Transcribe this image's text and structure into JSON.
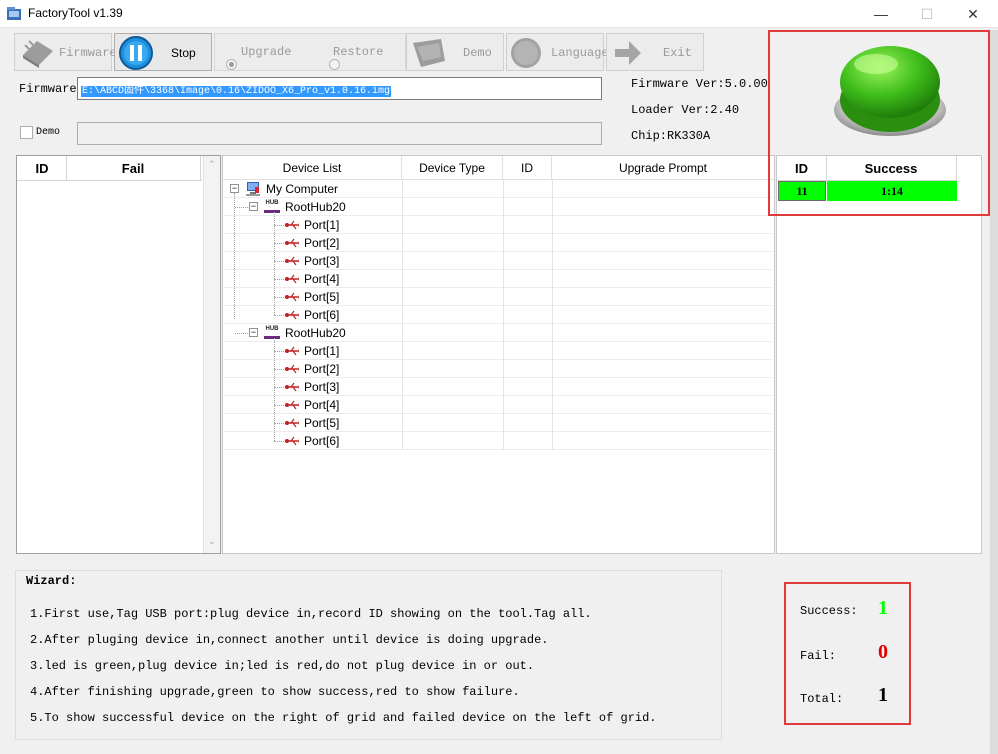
{
  "window": {
    "title": "FactoryTool v1.39",
    "minimize": "—",
    "maximize": "☐",
    "close": "✕"
  },
  "toolbar": {
    "firmware": "Firmware",
    "stop": "Stop",
    "upgrade": "Upgrade",
    "restore": "Restore",
    "demo": "Demo",
    "language": "Language",
    "exit": "Exit"
  },
  "firmware": {
    "label": "Firmware",
    "path": "E:\\ABCD固件\\3368\\Image\\0.16\\ZIDOO_X6_Pro_v1.0.16.img"
  },
  "demo": {
    "label": "Demo",
    "value": ""
  },
  "info": {
    "firmware_ver": "Firmware Ver:5.0.00",
    "loader_ver": "Loader Ver:2.40",
    "chip": "Chip:RK330A"
  },
  "fail_table": {
    "col_id": "ID",
    "col_fail": "Fail"
  },
  "device_table": {
    "col_list": "Device List",
    "col_type": "Device Type",
    "col_id": "ID",
    "col_prompt": "Upgrade Prompt",
    "root": "My Computer",
    "hubs": [
      {
        "name": "RootHub20",
        "ports": [
          "Port[1]",
          "Port[2]",
          "Port[3]",
          "Port[4]",
          "Port[5]",
          "Port[6]"
        ]
      },
      {
        "name": "RootHub20",
        "ports": [
          "Port[1]",
          "Port[2]",
          "Port[3]",
          "Port[4]",
          "Port[5]",
          "Port[6]"
        ]
      }
    ],
    "hub_badge": "HUB"
  },
  "success_table": {
    "col_id": "ID",
    "col_success": "Success",
    "rows": [
      {
        "id": "11",
        "value": "1:14"
      }
    ]
  },
  "wizard": {
    "title": "Wizard:",
    "lines": [
      "1.First use,Tag USB port:plug device in,record ID showing on the tool.Tag all.",
      "2.After pluging device in,connect another until device is doing upgrade.",
      "3.led is green,plug device in;led is red,do not plug device in or out.",
      "4.After finishing upgrade,green to show success,red to show failure.",
      "5.To show successful device on the right of grid and failed device on the left of grid."
    ]
  },
  "stats": {
    "success_label": "Success:",
    "success_value": "1",
    "fail_label": "Fail:",
    "fail_value": "0",
    "total_label": "Total:",
    "total_value": "1"
  },
  "colors": {
    "success_green": "#00ff00",
    "fail_red": "#e00000",
    "highlight": "#e03a3a",
    "selection": "#3399ff"
  }
}
